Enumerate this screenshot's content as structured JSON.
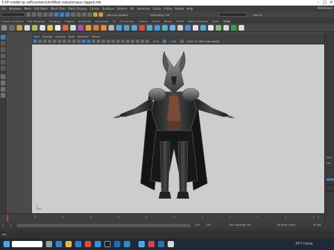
{
  "window": {
    "title": "3 Of model tp sdf\\contentUsr\\Mod maya\\maya rigged.mb",
    "controls": {
      "minimize": "–",
      "maximize": "□",
      "close": "✕"
    }
  },
  "menubar": {
    "items": [
      "File",
      "Windows",
      "Mesh",
      "Edit Mesh",
      "Mesh Tools",
      "Mesh Display",
      "Curves",
      "Surfaces",
      "Deform",
      "UV",
      "Generate",
      "Cache",
      "V-Ray",
      "Arnold",
      "Help"
    ],
    "workspace_label": "Workspace"
  },
  "statusline": {
    "surface_label": "No Live Surface",
    "symmetry_label": "Symmetry: Off",
    "signin_label": "Sign In"
  },
  "shelf": {
    "tabs": [
      "Curves / Surfaces",
      "Poly Modeling",
      "Sculpting",
      "Rigging",
      "Animation",
      "Rendering",
      "FX",
      "FX Caching",
      "Custom",
      "Arnold",
      "Bifrost",
      "MASH",
      "Motion Graphics",
      "XGen",
      "V-Ray"
    ],
    "active_tab": "V-Ray"
  },
  "viewport": {
    "panel_menu": [
      "View",
      "Shading",
      "Lighting",
      "Show",
      "Renderer",
      "Panels"
    ],
    "camera_near": "0.00",
    "camera_far": "1.00",
    "color_space": "ACES 1.0 SDR-video (sRGB)",
    "axis_label_x": "x",
    "axis_label_y": "y",
    "background_color": "#cdcdcd"
  },
  "timeline": {
    "start": "1",
    "end": "120",
    "range_start": "1",
    "range_end": "120",
    "current_frame": "1",
    "character_set_label": "No Character Set",
    "anim_layer_label": "No Anim Layer",
    "fps_label": "24 fps"
  },
  "helpline": {
    "mode": "MEL",
    "text": ""
  },
  "rightpanel": {
    "labels": [
      "Cha",
      "Lay"
    ]
  },
  "taskbar": {
    "weather": "60°F Cloudy",
    "tray_text": "",
    "search_placeholder": ""
  }
}
